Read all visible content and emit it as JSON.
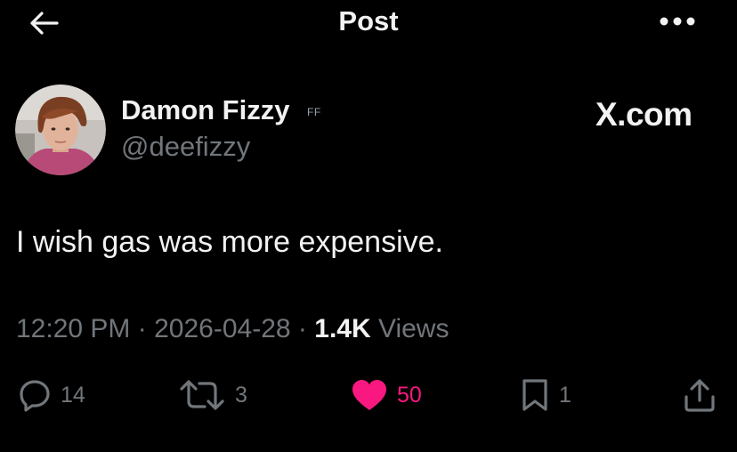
{
  "header": {
    "title": "Post",
    "back_icon": "arrow-left-icon",
    "more_icon": "more-horizontal-icon"
  },
  "author": {
    "name": "Damon Fizzy",
    "badge": "FF",
    "handle": "@deefizzy",
    "avatar_icon": "avatar"
  },
  "watermark": "X.com",
  "post": {
    "text": "I wish gas was more expensive."
  },
  "meta": {
    "time": "12:20 PM",
    "separator": "·",
    "date": "2026-04-28",
    "views_count": "1.4K",
    "views_label": "Views"
  },
  "actions": {
    "replies": "14",
    "reposts": "3",
    "likes": "50",
    "bookmarks": "1"
  },
  "colors": {
    "background": "#000000",
    "primary_text": "#f2f2f2",
    "secondary_text": "#71767b",
    "like_pink": "#f91880"
  }
}
